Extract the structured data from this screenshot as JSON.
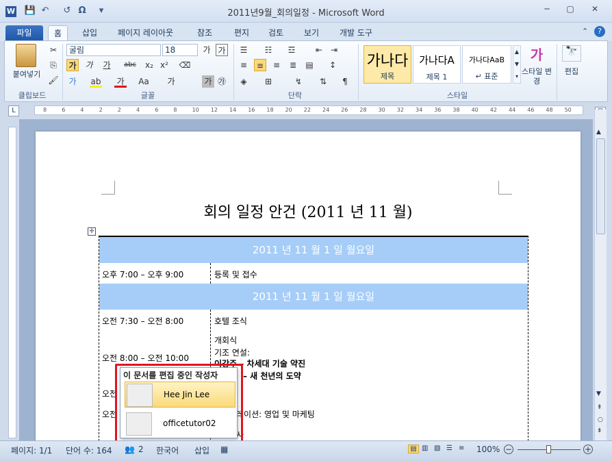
{
  "window": {
    "title": "2011년9월_회의일정 - Microsoft Word",
    "minimize": "─",
    "restore": "▢",
    "close": "✕"
  },
  "qat": {
    "undo": "↶",
    "redo": "↺",
    "symbol": "Ω",
    "more": "▾"
  },
  "tabs": [
    "파일",
    "홈",
    "삽입",
    "페이지 레이아웃",
    "참조",
    "편지",
    "검토",
    "보기",
    "개발 도구"
  ],
  "ribbon": {
    "clipboard": {
      "label": "클립보드",
      "paste": "붙여넣기"
    },
    "font": {
      "label": "글꼴",
      "font_name": "굴림",
      "font_size": "18"
    },
    "paragraph": {
      "label": "단락"
    },
    "styles": {
      "label": "스타일",
      "items": [
        {
          "preview": "가나다",
          "name": "제목"
        },
        {
          "preview": "가나다A",
          "name": "제목 1"
        },
        {
          "preview": "가나다AaB",
          "name": "↵ 표준"
        }
      ],
      "change_styles": "스타일 변경"
    },
    "editing": {
      "label": "편집"
    }
  },
  "ruler": {
    "marks": [
      "8",
      "6",
      "4",
      "2",
      "2",
      "4",
      "6",
      "8",
      "10",
      "12",
      "14",
      "16",
      "18",
      "20",
      "22",
      "24",
      "26",
      "28",
      "30",
      "32",
      "34",
      "36",
      "38",
      "40",
      "42",
      "44",
      "46",
      "48",
      "50"
    ]
  },
  "document": {
    "title": "회의 일정 안건 (2011 년 11 월)",
    "rows": [
      {
        "type": "day",
        "text": "2011 년 11 월 1 일 월요일"
      },
      {
        "type": "item",
        "time": "오후 7:00 – 오후 9:00",
        "desc": "등록 및 접수"
      },
      {
        "type": "day",
        "text": "2011 년 11 월 1 일 월요일"
      },
      {
        "type": "item",
        "time": "오전 7:30 – 오전 8:00",
        "desc": "호텔 조식"
      }
    ],
    "session": {
      "time": "오전 8:00 – 오전 10:00",
      "l1": "개회식",
      "l2": "기조 연설:",
      "l3": "이강주 – 차세대 기술 약진",
      "l4": "– 새 천년의 도약"
    },
    "partial_time_1": "오전",
    "partial_time_2": "오전",
    "partial_desc": "레이션:  영업 및 마케팅",
    "partial_desc2": "사"
  },
  "authors_popup": {
    "header": "이 문서를 편집 중인 작성자",
    "authors": [
      "Hee Jin Lee",
      "officetutor02"
    ]
  },
  "status": {
    "page": "페이지: 1/1",
    "words": "단어 수: 164",
    "authors_count": "2",
    "language": "한국어",
    "mode": "삽입",
    "zoom": "100%"
  }
}
